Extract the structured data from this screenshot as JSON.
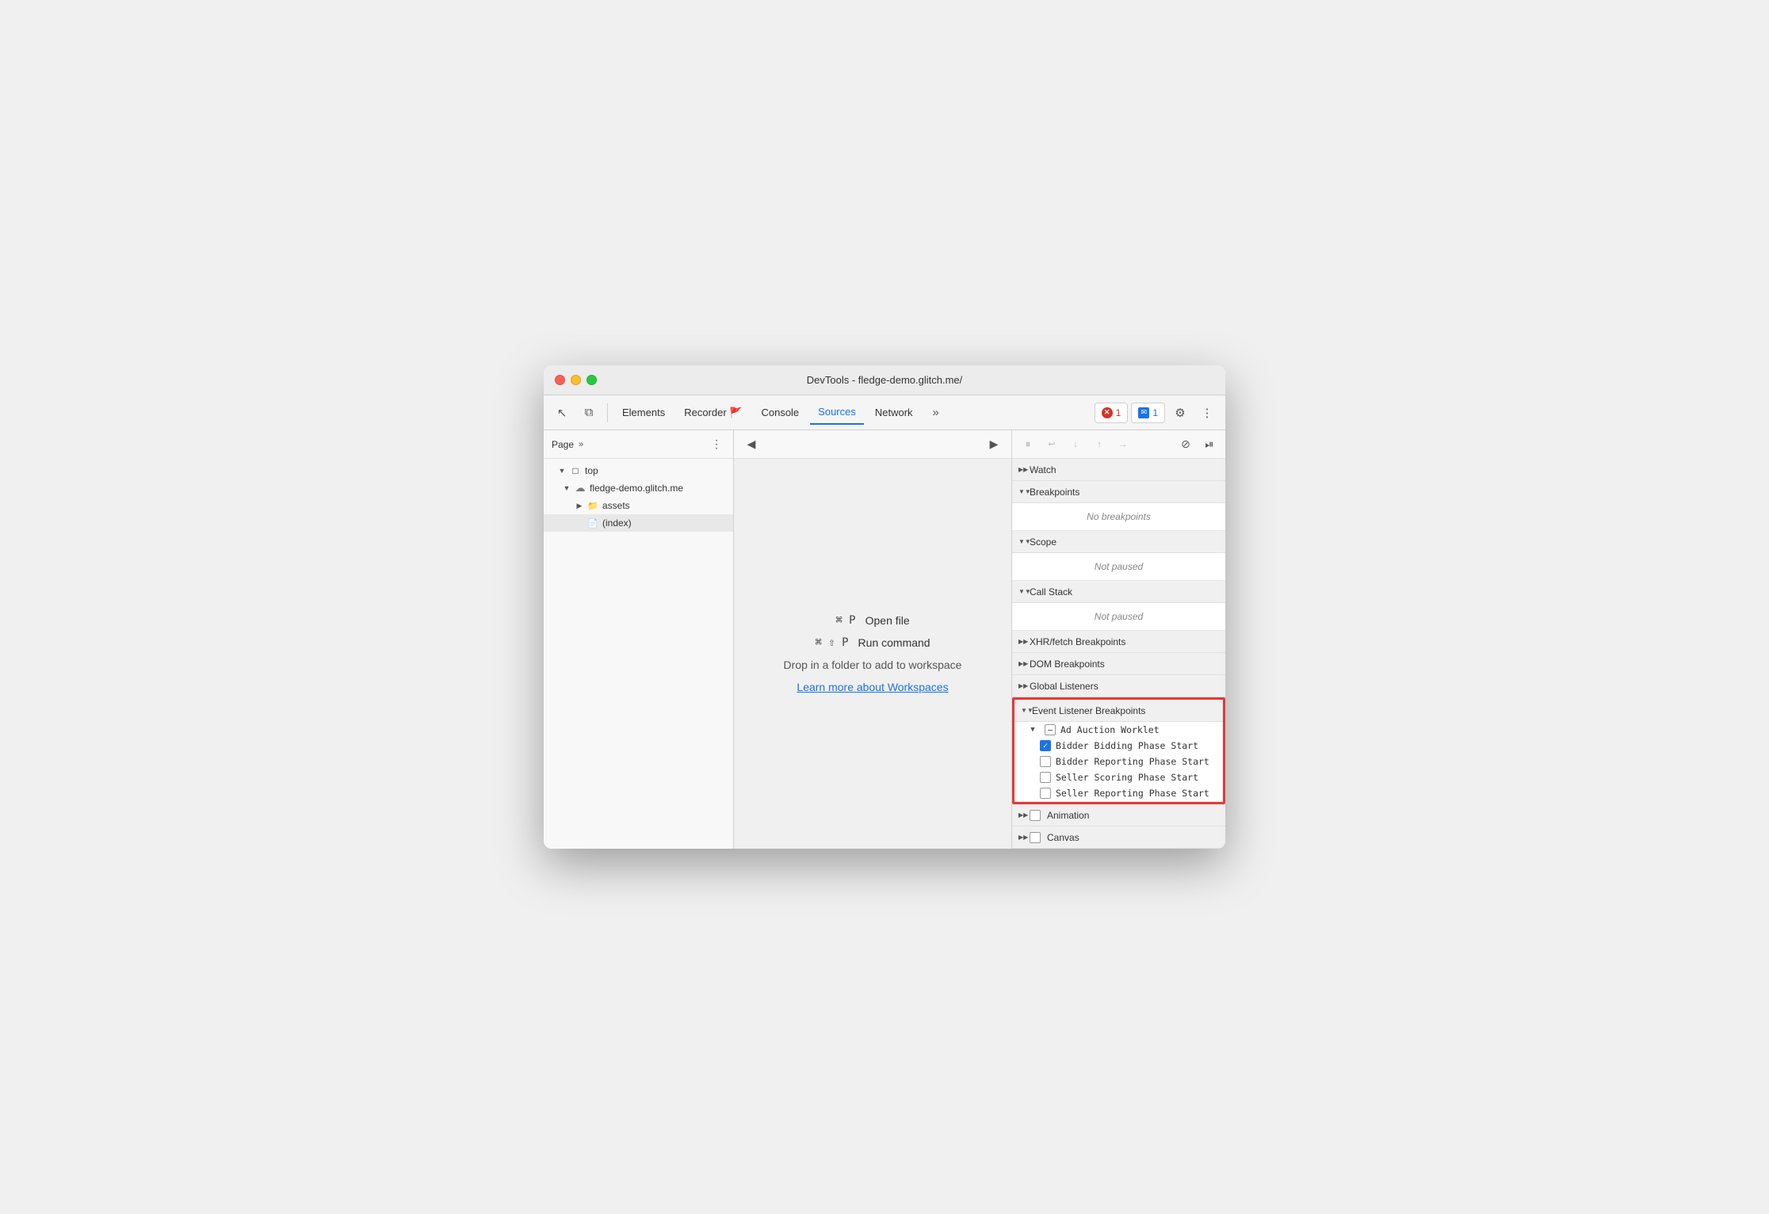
{
  "window": {
    "title": "DevTools - fledge-demo.glitch.me/"
  },
  "toolbar": {
    "tabs": [
      {
        "id": "elements",
        "label": "Elements",
        "active": false
      },
      {
        "id": "recorder",
        "label": "Recorder 🚩",
        "active": false
      },
      {
        "id": "console",
        "label": "Console",
        "active": false
      },
      {
        "id": "sources",
        "label": "Sources",
        "active": true
      },
      {
        "id": "network",
        "label": "Network",
        "active": false
      }
    ],
    "more_tabs": "»",
    "error_count": "1",
    "message_count": "1",
    "settings_icon": "⚙",
    "more_icon": "⋮"
  },
  "sidebar": {
    "title": "Page",
    "more_icon": "»",
    "menu_icon": "⋮",
    "tree": [
      {
        "level": 0,
        "type": "folder",
        "label": "top",
        "expanded": true,
        "arrow": "▼"
      },
      {
        "level": 1,
        "type": "cloud",
        "label": "fledge-demo.glitch.me",
        "expanded": true,
        "arrow": "▼"
      },
      {
        "level": 2,
        "type": "folder",
        "label": "assets",
        "expanded": false,
        "arrow": "▶"
      },
      {
        "level": 2,
        "type": "file",
        "label": "(index)",
        "selected": true
      }
    ]
  },
  "center": {
    "shortcuts": [
      {
        "key": "⌘ P",
        "label": "Open file"
      },
      {
        "key": "⌘ ⇧ P",
        "label": "Run command"
      }
    ],
    "workspace_text": "Drop in a folder to add to workspace",
    "workspace_link": "Learn more about Workspaces"
  },
  "debugger": {
    "sections": [
      {
        "id": "watch",
        "label": "Watch",
        "expanded": false,
        "arrow": "▶"
      },
      {
        "id": "breakpoints",
        "label": "Breakpoints",
        "expanded": true,
        "arrow": "▼",
        "empty_text": "No breakpoints"
      },
      {
        "id": "scope",
        "label": "Scope",
        "expanded": true,
        "arrow": "▼",
        "empty_text": "Not paused"
      },
      {
        "id": "callstack",
        "label": "Call Stack",
        "expanded": true,
        "arrow": "▼",
        "empty_text": "Not paused"
      },
      {
        "id": "xhr",
        "label": "XHR/fetch Breakpoints",
        "expanded": false,
        "arrow": "▶"
      },
      {
        "id": "dom",
        "label": "DOM Breakpoints",
        "expanded": false,
        "arrow": "▶"
      },
      {
        "id": "global",
        "label": "Global Listeners",
        "expanded": false,
        "arrow": "▶"
      },
      {
        "id": "event_listener",
        "label": "Event Listener Breakpoints",
        "expanded": true,
        "arrow": "▼",
        "highlighted": true,
        "subsections": [
          {
            "id": "ad_auction",
            "label": "Ad Auction Worklet",
            "expanded": true,
            "arrow": "▼",
            "has_minus": true,
            "items": [
              {
                "id": "bidder_bidding",
                "label": "Bidder Bidding Phase Start",
                "checked": true
              },
              {
                "id": "bidder_reporting",
                "label": "Bidder Reporting Phase Start",
                "checked": false
              },
              {
                "id": "seller_scoring",
                "label": "Seller Scoring Phase Start",
                "checked": false
              },
              {
                "id": "seller_reporting",
                "label": "Seller Reporting Phase Start",
                "checked": false
              }
            ]
          }
        ]
      },
      {
        "id": "animation",
        "label": "Animation",
        "expanded": false,
        "arrow": "▶",
        "has_checkbox": true
      },
      {
        "id": "canvas",
        "label": "Canvas",
        "expanded": false,
        "arrow": "▶",
        "has_checkbox": true
      }
    ]
  }
}
